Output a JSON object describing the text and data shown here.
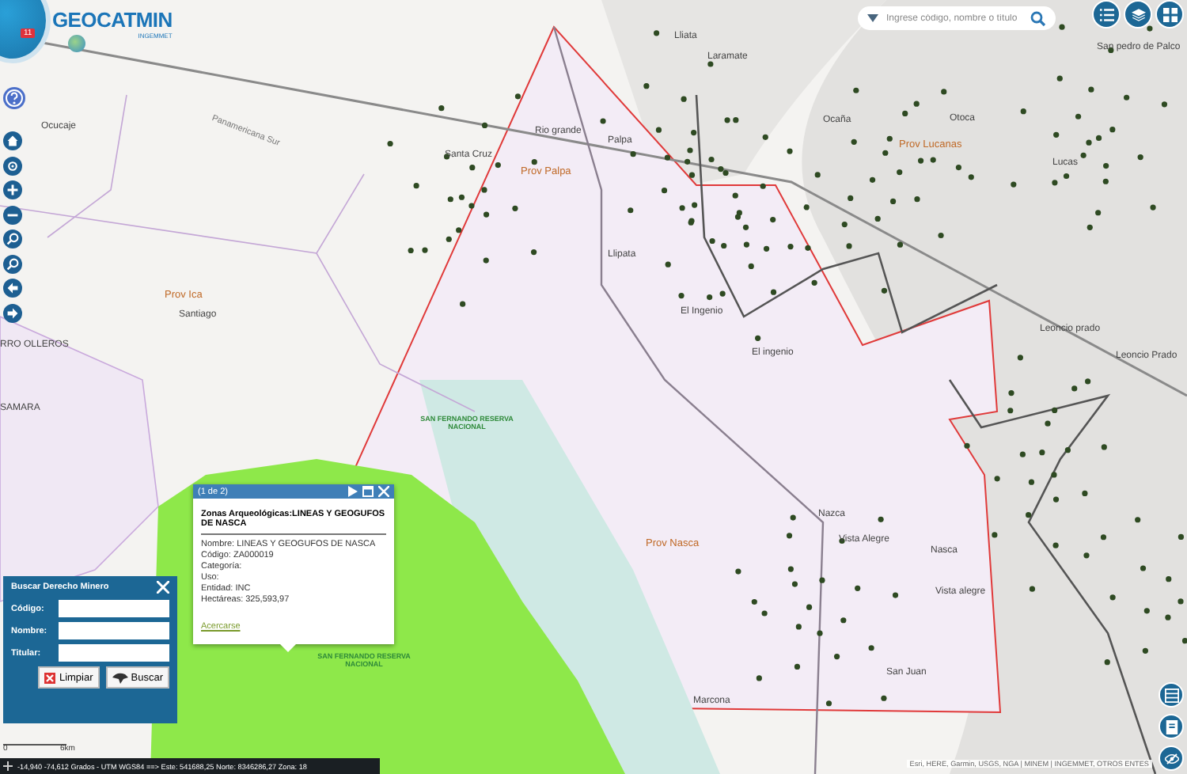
{
  "logo": {
    "title": "GEOCATMIN",
    "subtitle": "INGEMMET",
    "badge": "11"
  },
  "search": {
    "placeholder": "Ingrese código, nombre o título"
  },
  "map_labels": [
    {
      "text": "Ocucaje",
      "kind": "place"
    },
    {
      "text": "Prov Ica",
      "kind": "province"
    },
    {
      "text": "Santiago",
      "kind": "place"
    },
    {
      "text": "Panamericana Sur",
      "kind": "road"
    },
    {
      "text": "Rio grande",
      "kind": "place"
    },
    {
      "text": "Santa Cruz",
      "kind": "place"
    },
    {
      "text": "Prov Palpa",
      "kind": "province"
    },
    {
      "text": "Palpa",
      "kind": "place"
    },
    {
      "text": "Llipata",
      "kind": "place"
    },
    {
      "text": "Lliata",
      "kind": "place"
    },
    {
      "text": "Laramate",
      "kind": "place"
    },
    {
      "text": "Ocaña",
      "kind": "place"
    },
    {
      "text": "Otoca",
      "kind": "place"
    },
    {
      "text": "Prov Lucanas",
      "kind": "province"
    },
    {
      "text": "San pedro de Palco",
      "kind": "place"
    },
    {
      "text": "Lucas",
      "kind": "place"
    },
    {
      "text": "El Ingenio",
      "kind": "place"
    },
    {
      "text": "El ingenio",
      "kind": "place"
    },
    {
      "text": "Leoncio prado",
      "kind": "place"
    },
    {
      "text": "Leoncio Prado",
      "kind": "place"
    },
    {
      "text": "SAN FERNANDO RESERVA NACIONAL",
      "kind": "reserve"
    },
    {
      "text": "Prov Nasca",
      "kind": "province"
    },
    {
      "text": "Nazca",
      "kind": "place"
    },
    {
      "text": "Vista Alegre",
      "kind": "place"
    },
    {
      "text": "Nasca",
      "kind": "place"
    },
    {
      "text": "Vista alegre",
      "kind": "place"
    },
    {
      "text": "San Juan",
      "kind": "place"
    },
    {
      "text": "SAN FERNANDO RESERVA NACIONAL",
      "kind": "reserve"
    },
    {
      "text": "Marcona",
      "kind": "place"
    },
    {
      "text": "RRO OLLEROS",
      "kind": "place"
    },
    {
      "text": "SAMARA",
      "kind": "place"
    }
  ],
  "popup": {
    "counter": "(1 de 2)",
    "title": "Zonas Arqueológicas:LINEAS Y GEOGUFOS DE NASCA",
    "fields": [
      "Nombre: LINEAS Y GEOGUFOS DE NASCA",
      "Código: ZA000019",
      "Categoría:",
      "Uso:",
      "Entidad: INC",
      "Hectáreas: 325,593,97"
    ],
    "link": "Acercarse"
  },
  "search_panel": {
    "title": "Buscar Derecho Minero",
    "fields": [
      {
        "label": "Código:"
      },
      {
        "label": "Nombre:"
      },
      {
        "label": "Titular:"
      }
    ],
    "buttons": [
      "Limpiar",
      "Buscar"
    ]
  },
  "scale": {
    "labels": [
      "0",
      "6km"
    ]
  },
  "status_bar": "-14,940 -74,612 Grados - UTM WGS84 ==> Este: 541688,25 Norte: 8346286,27 Zona: 18",
  "attribution": "Esri, HERE, Garmin, USGS, NGA | MINEM | INGEMMET, OTROS ENTES"
}
